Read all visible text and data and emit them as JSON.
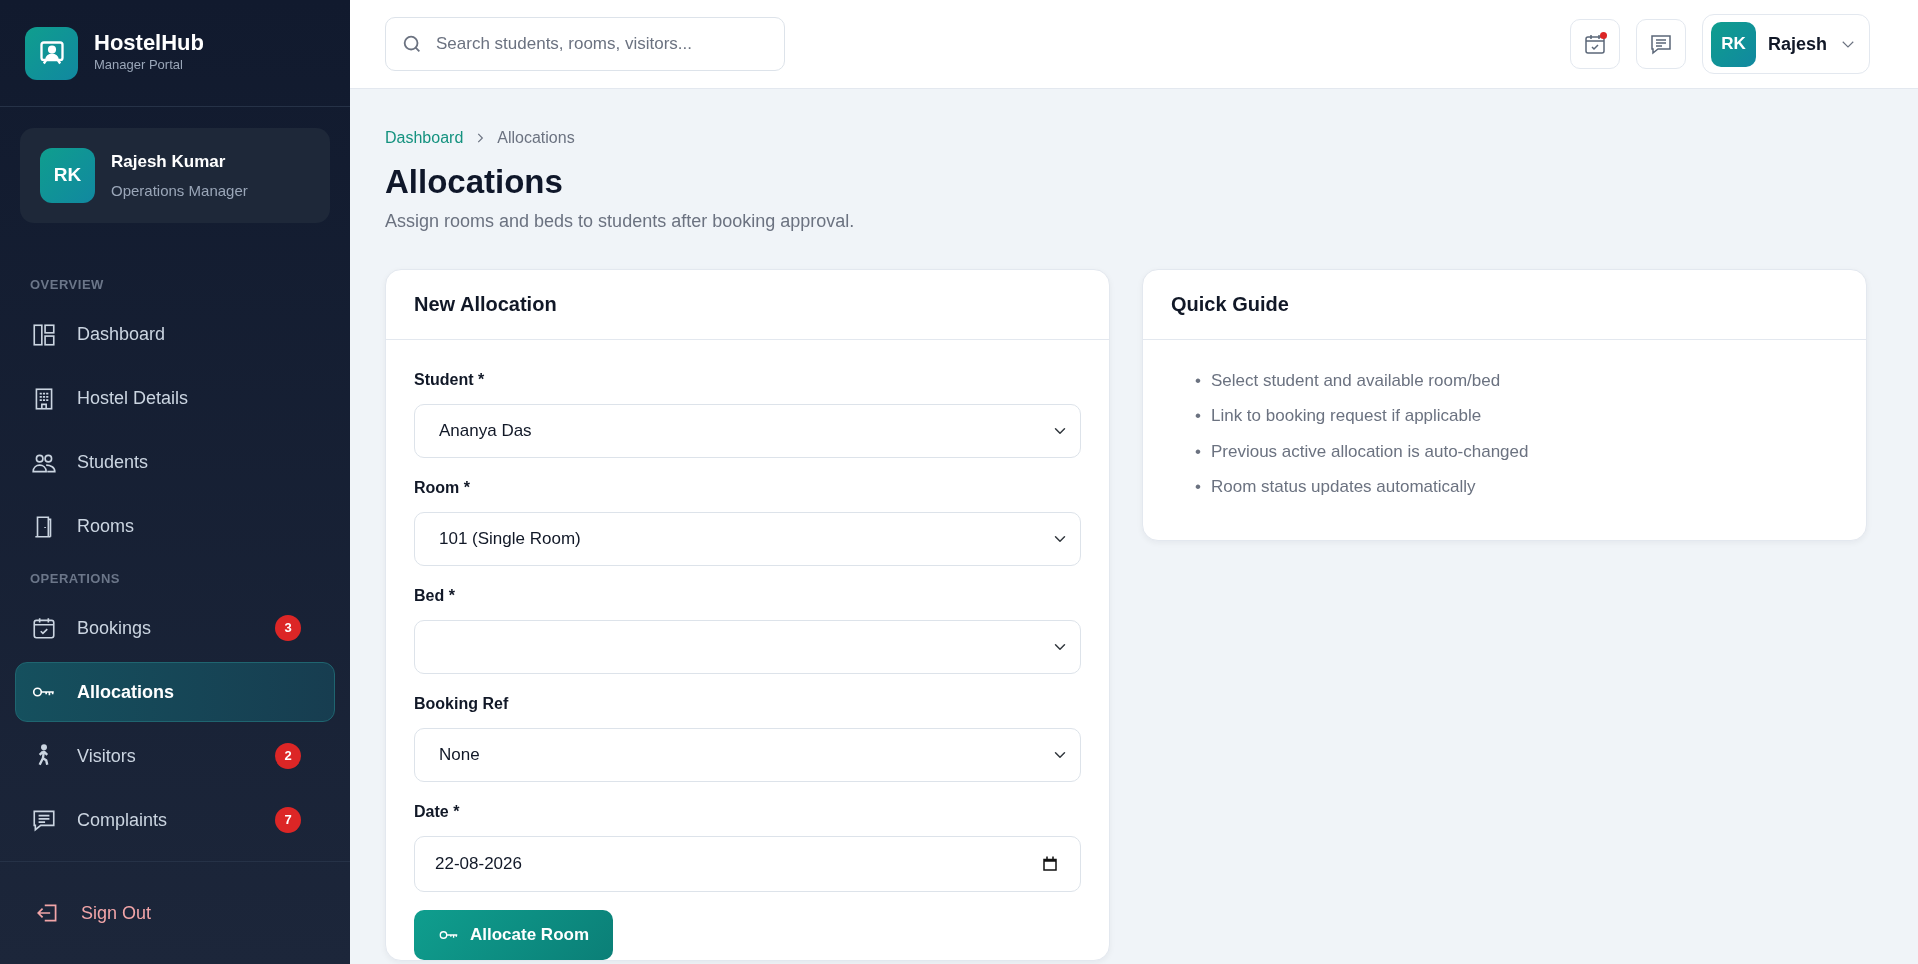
{
  "brand": {
    "name": "HostelHub",
    "subtitle": "Manager Portal"
  },
  "user_card": {
    "initials": "RK",
    "name": "Rajesh Kumar",
    "role": "Operations Manager"
  },
  "sidebar": {
    "sections": [
      {
        "title": "OVERVIEW",
        "items": [
          {
            "label": "Dashboard",
            "selected": false
          },
          {
            "label": "Hostel Details",
            "selected": false
          },
          {
            "label": "Students",
            "selected": false
          },
          {
            "label": "Rooms",
            "selected": false
          }
        ]
      },
      {
        "title": "OPERATIONS",
        "items": [
          {
            "label": "Bookings",
            "selected": false,
            "badge": "3"
          },
          {
            "label": "Allocations",
            "selected": true
          },
          {
            "label": "Visitors",
            "selected": false,
            "badge": "2"
          },
          {
            "label": "Complaints",
            "selected": false,
            "badge": "7"
          }
        ]
      }
    ],
    "sign_out": "Sign Out"
  },
  "search": {
    "placeholder": "Search students, rooms, visitors..."
  },
  "topbar": {
    "buttons": [
      {
        "dot": true
      },
      {
        "dot": false
      }
    ],
    "profile": {
      "initials": "RK",
      "name": "Rajesh"
    }
  },
  "breadcrumb": [
    {
      "label": "Dashboard",
      "link": true
    },
    {
      "label": "Allocations",
      "link": false
    }
  ],
  "page": {
    "title": "Allocations",
    "subtitle": "Assign rooms and beds to students after booking approval."
  },
  "form": {
    "title": "New Allocation",
    "fields": [
      {
        "label": "Student *",
        "kind": "select",
        "value": "Ananya Das"
      },
      {
        "label": "Room *",
        "kind": "select",
        "value": "101 (Single Room)"
      },
      {
        "label": "Bed *",
        "kind": "select"
      },
      {
        "label": "Booking Ref",
        "kind": "select",
        "value": "None"
      },
      {
        "label": "Date *",
        "kind": "date",
        "value": "22-08-2026"
      }
    ],
    "submit": "Allocate Room"
  },
  "guide": {
    "title": "Quick Guide",
    "items": [
      {
        "bullet": "•",
        "text": "Select student and available room/bed"
      },
      {
        "bullet": "•",
        "text": "Link to booking request if applicable"
      },
      {
        "bullet": "•",
        "text": "Previous active allocation is auto-changed"
      },
      {
        "bullet": "•",
        "text": "Room status updates automatically"
      }
    ]
  }
}
